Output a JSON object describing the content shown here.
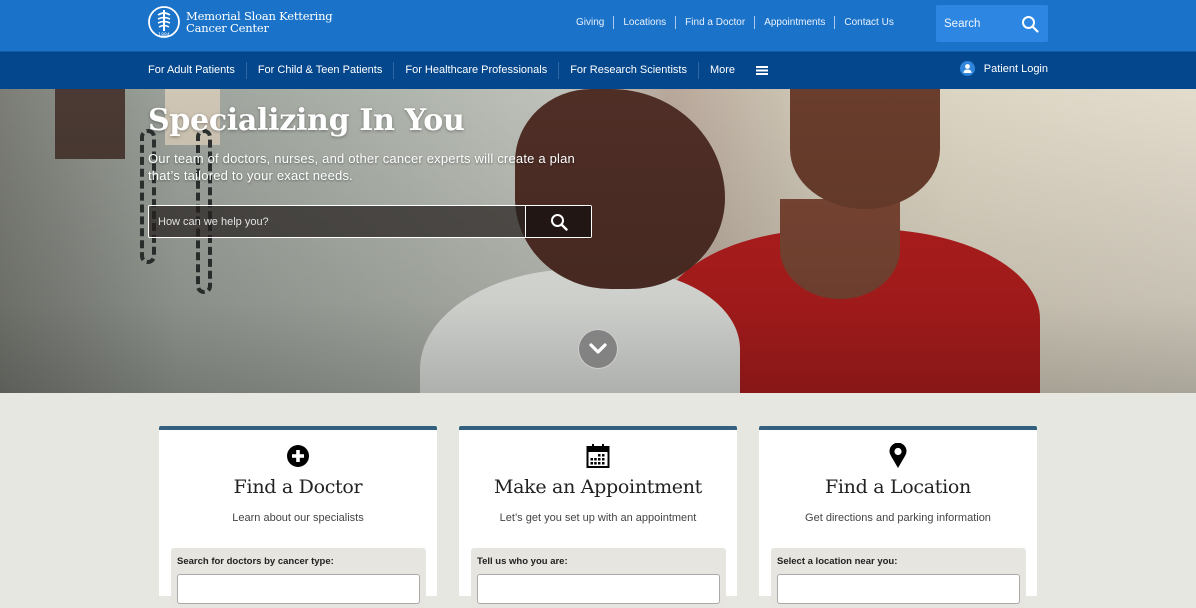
{
  "brand": {
    "name_line1": "Memorial Sloan Kettering",
    "name_line2": "Cancer Center",
    "logo_year": "1884",
    "colors": {
      "topbar": "#1a73c9",
      "mainnav": "#04478c",
      "card_accent": "#33607f"
    }
  },
  "utility_nav": {
    "items": [
      {
        "label": "Giving"
      },
      {
        "label": "Locations"
      },
      {
        "label": "Find a Doctor"
      },
      {
        "label": "Appointments"
      },
      {
        "label": "Contact Us"
      }
    ],
    "search": {
      "placeholder": "Search",
      "icon": "search-icon"
    }
  },
  "main_nav": {
    "items": [
      {
        "label": "For Adult Patients"
      },
      {
        "label": "For Child & Teen Patients"
      },
      {
        "label": "For Healthcare Professionals"
      },
      {
        "label": "For Research Scientists"
      },
      {
        "label": "More"
      }
    ],
    "more_icon": "hamburger-menu-icon",
    "patient_login": {
      "label": "Patient Login",
      "icon": "user-icon"
    }
  },
  "hero": {
    "title": "Specializing In You",
    "subtitle": "Our team of doctors, nurses, and other cancer experts will create a plan that’s tailored to your exact needs.",
    "search_placeholder": "How can we help you?",
    "search_icon": "search-icon",
    "scroll_icon": "chevron-down-icon"
  },
  "cards": [
    {
      "icon": "plus-circle-icon",
      "title": "Find a Doctor",
      "description": "Learn about our specialists",
      "form_label": "Search for doctors by cancer type:"
    },
    {
      "icon": "calendar-icon",
      "title": "Make an Appointment",
      "description": "Let’s get you set up with an appointment",
      "form_label": "Tell us who you are:"
    },
    {
      "icon": "map-pin-icon",
      "title": "Find a Location",
      "description": "Get directions and parking information",
      "form_label": "Select a location near you:"
    }
  ]
}
